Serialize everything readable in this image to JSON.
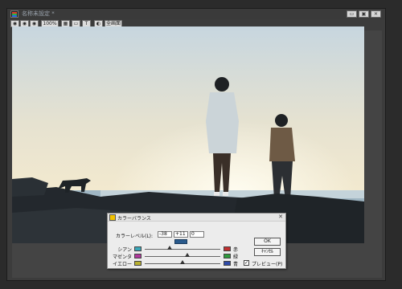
{
  "window": {
    "title": "名称未設定 *",
    "buttons": {
      "minimize": "▭",
      "restore": "▣",
      "close": "✕"
    }
  },
  "toolbar": {
    "buttons": [
      "◉",
      "◉",
      "◉",
      "100%",
      "▦",
      "▭",
      "T",
      "◐",
      "全画面"
    ]
  },
  "dialog": {
    "title": "カラーバランス",
    "close": "✕",
    "level_label": "カラーレベル(L):",
    "levels": [
      "-38",
      "+11",
      "0"
    ],
    "sliders": [
      {
        "left": "シアン",
        "right": "赤",
        "value": 0.33,
        "left_color": "#3aa6b8",
        "right_color": "#c03030"
      },
      {
        "left": "マゼンタ",
        "right": "緑",
        "value": 0.56,
        "left_color": "#b0389c",
        "right_color": "#2e9a3c"
      },
      {
        "left": "イエロー",
        "right": "青",
        "value": 0.5,
        "left_color": "#b8b030",
        "right_color": "#2e4aa8"
      }
    ],
    "ok_label": "OK",
    "cancel_label": "ｷｬﾝｾﾙ",
    "preview_label": "プレビュー(P)",
    "preview_checked": "✓"
  }
}
